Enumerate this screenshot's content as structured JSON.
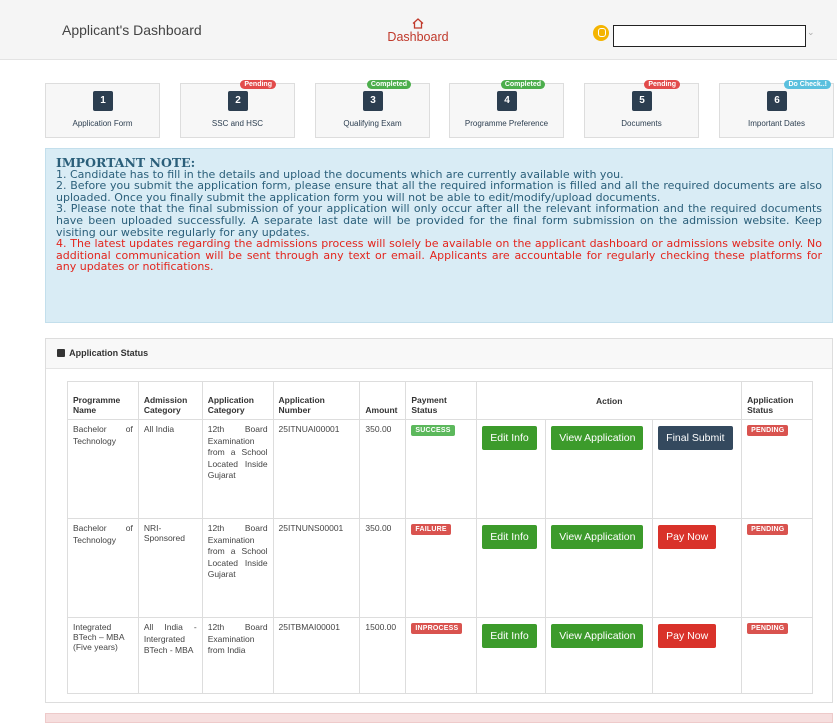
{
  "header": {
    "app_title": "Applicant's Dashboard",
    "dashboard_link": "Dashboard",
    "user_name": ""
  },
  "steps": [
    {
      "num": "1",
      "label": "Application Form",
      "badge": "",
      "badge_color": ""
    },
    {
      "num": "2",
      "label": "SSC and HSC",
      "badge": "Pending",
      "badge_color": "#e24b4b"
    },
    {
      "num": "3",
      "label": "Qualifying Exam",
      "badge": "Completed",
      "badge_color": "#4cae4c"
    },
    {
      "num": "4",
      "label": "Programme Preference",
      "badge": "Completed",
      "badge_color": "#4cae4c"
    },
    {
      "num": "5",
      "label": "Documents",
      "badge": "Pending",
      "badge_color": "#e24b4b"
    },
    {
      "num": "6",
      "label": "Important Dates",
      "badge": "Do Check..!",
      "badge_color": "#5bc0de"
    }
  ],
  "note": {
    "title": "IMPORTANT NOTE:",
    "p1": "1. Candidate has to fill in the details and upload the documents which are currently available with you.",
    "p2": "2. Before you submit the application form, please ensure that all the required information is filled and all the required documents are also uploaded. Once you finally submit the application form you will not be able to edit/modify/upload documents.",
    "p3": "3. Please note that the final submission of your application will only occur after all the relevant information and the required documents have been uploaded successfully. A separate last date will be provided for the final form submission on the admission website. Keep visiting our website regularly for any updates.",
    "p4": "4. The latest updates regarding the admissions process will solely be available on the applicant dashboard or admissions website only. No additional communication will be sent through any text or email. Applicants are accountable for regularly checking these platforms for any updates or notifications."
  },
  "status_panel": {
    "title": "Application Status",
    "headers": {
      "programme": "Programme Name",
      "admission_category": "Admission Category",
      "application_category": "Application Category",
      "application_number": "Application Number",
      "amount": "Amount",
      "payment_status": "Payment Status",
      "action": "Action",
      "application_status": "Application Status"
    },
    "rows": [
      {
        "programme": "Bachelor of Technology",
        "admission_category": "All India",
        "application_category": "12th Board Examination from a School Located Inside Gujarat",
        "application_number": "25ITNUAI00001",
        "amount": "350.00",
        "payment_status": "SUCCESS",
        "payment_color": "#5cb85c",
        "btn_edit": "Edit Info",
        "btn_view": "View Application",
        "btn_third": "Final Submit",
        "app_status": "PENDING"
      },
      {
        "programme": "Bachelor of Technology",
        "admission_category": "NRI-Sponsored",
        "application_category": "12th Board Examination from a School Located Inside Gujarat",
        "application_number": "25ITNUNS00001",
        "amount": "350.00",
        "payment_status": "FAILURE",
        "payment_color": "#d9534f",
        "btn_edit": "Edit Info",
        "btn_view": "View Application",
        "btn_third": "Pay Now",
        "app_status": "PENDING"
      },
      {
        "programme": "Integrated BTech – MBA (Five years)",
        "admission_category": "All India - Intergrated BTech - MBA",
        "application_category": "12th Board Examination from India",
        "application_number": "25ITBMAI00001",
        "amount": "1500.00",
        "payment_status": "INPROCESS",
        "payment_color": "#d9534f",
        "btn_edit": "Edit Info",
        "btn_view": "View Application",
        "btn_third": "Pay Now",
        "app_status": "PENDING"
      }
    ]
  }
}
